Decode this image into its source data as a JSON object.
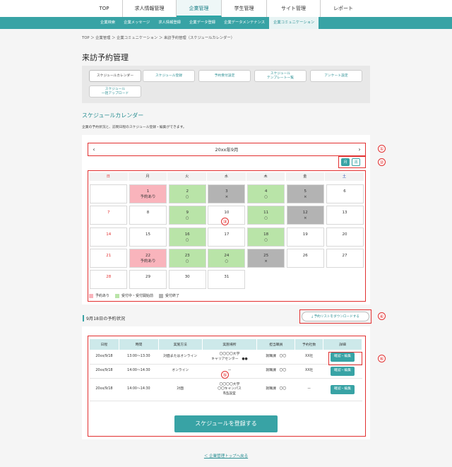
{
  "top_nav": [
    {
      "label": "TOP",
      "active": false
    },
    {
      "label": "求人情報管理",
      "active": false
    },
    {
      "label": "企業管理",
      "active": true
    },
    {
      "label": "学生管理",
      "active": false
    },
    {
      "label": "サイト管理",
      "active": false
    },
    {
      "label": "レポート",
      "active": false
    }
  ],
  "sub_nav": [
    {
      "label": "企業検索",
      "active": false
    },
    {
      "label": "企業メッセージ",
      "active": false
    },
    {
      "label": "求人情報登録",
      "active": false
    },
    {
      "label": "企業データ登録",
      "active": false
    },
    {
      "label": "企業データメンテナンス",
      "active": false
    },
    {
      "label": "企業コミュニケーション",
      "active": true
    }
  ],
  "breadcrumb": "TOP ＞ 企業管理 ＞ 企業コミュニケーション ＞ 来訪予約管理（スケジュールカレンダー）",
  "page_title": "来訪予約管理",
  "tabs": [
    {
      "label": "スケジュールカレンダー"
    },
    {
      "label": "スケジュール登録"
    },
    {
      "label": "予約受付設定"
    },
    {
      "label": "スケジュール\nテンプレート一覧"
    },
    {
      "label": "アンケート設定"
    },
    {
      "label": "スケジュール\n一括アップロード"
    }
  ],
  "section_title": "スケジュールカレンダー",
  "section_desc": "企業の予約状況と、訪問日程のスケジュール登録・編集ができます。",
  "calendar": {
    "month_label": "20xx年9月",
    "prev_icon": "‹",
    "next_icon": "›",
    "view_month": "月",
    "view_week": "週",
    "dow": [
      "日",
      "月",
      "火",
      "水",
      "木",
      "金",
      "土"
    ],
    "weeks": [
      [
        {
          "d": "",
          "s": "",
          "t": ""
        },
        {
          "d": "1",
          "s": "booked",
          "t": "予約あり"
        },
        {
          "d": "2",
          "s": "open",
          "t": "○"
        },
        {
          "d": "3",
          "s": "closed",
          "t": "×"
        },
        {
          "d": "4",
          "s": "open",
          "t": "○"
        },
        {
          "d": "5",
          "s": "closed",
          "t": "×"
        },
        {
          "d": "6",
          "s": "",
          "t": ""
        }
      ],
      [
        {
          "d": "7",
          "s": "",
          "t": ""
        },
        {
          "d": "8",
          "s": "",
          "t": ""
        },
        {
          "d": "9",
          "s": "open",
          "t": "○"
        },
        {
          "d": "10",
          "s": "",
          "t": ""
        },
        {
          "d": "11",
          "s": "open",
          "t": "○"
        },
        {
          "d": "12",
          "s": "closed",
          "t": "×"
        },
        {
          "d": "13",
          "s": "",
          "t": ""
        }
      ],
      [
        {
          "d": "14",
          "s": "",
          "t": ""
        },
        {
          "d": "15",
          "s": "",
          "t": ""
        },
        {
          "d": "16",
          "s": "open",
          "t": "○"
        },
        {
          "d": "17",
          "s": "",
          "t": ""
        },
        {
          "d": "18",
          "s": "open",
          "t": "○"
        },
        {
          "d": "19",
          "s": "",
          "t": ""
        },
        {
          "d": "20",
          "s": "",
          "t": ""
        }
      ],
      [
        {
          "d": "21",
          "s": "",
          "t": ""
        },
        {
          "d": "22",
          "s": "booked",
          "t": "予約あり"
        },
        {
          "d": "23",
          "s": "open",
          "t": "○"
        },
        {
          "d": "24",
          "s": "open",
          "t": "○"
        },
        {
          "d": "25",
          "s": "closed",
          "t": "×"
        },
        {
          "d": "26",
          "s": "",
          "t": ""
        },
        {
          "d": "27",
          "s": "",
          "t": ""
        }
      ],
      [
        {
          "d": "28",
          "s": "",
          "t": ""
        },
        {
          "d": "29",
          "s": "",
          "t": ""
        },
        {
          "d": "30",
          "s": "",
          "t": ""
        },
        {
          "d": "31",
          "s": "",
          "t": ""
        },
        {
          "d": "",
          "s": "none",
          "t": ""
        },
        {
          "d": "",
          "s": "none",
          "t": ""
        },
        {
          "d": "",
          "s": "none",
          "t": ""
        }
      ]
    ],
    "legend": [
      {
        "label": "予約あり",
        "color": "#f9b4bc"
      },
      {
        "label": "受付中・受付開始前",
        "color": "#b9e4a8"
      },
      {
        "label": "受付終了",
        "color": "#b3b3b3"
      }
    ]
  },
  "download_button": "予約リストをダウンロードする",
  "bookings_title": "9月18日の予約状況",
  "table": {
    "headers": [
      "日程",
      "時間",
      "実施方法",
      "実施場所",
      "担当職員",
      "予約社数",
      "詳細"
    ],
    "rows": [
      [
        "20xx/9/18",
        "13:00〜13:30",
        "対面またはオンライン",
        "〇〇〇〇大学\nキャリアセンター　●●",
        "就職課　〇〇",
        "XX社",
        "確認・編集"
      ],
      [
        "20xx/9/18",
        "14:00〜14:30",
        "オンライン",
        "ー",
        "就職課　〇〇",
        "XX社",
        "確認・編集"
      ],
      [
        "20xx/9/18",
        "14:00〜14:30",
        "対面",
        "〇〇〇〇大学\n〇〇キャンパス\nB品設室",
        "就職課　〇〇",
        "ー",
        "確認・編集"
      ]
    ]
  },
  "register_button": "スケジュールを登録する",
  "back_link": "＜ 企業管理トップへ戻る",
  "markers": [
    "①",
    "②",
    "③",
    "④",
    "⑤",
    "⑥"
  ],
  "colors": {
    "accent": "#38a3a5",
    "annotation": "#e23030"
  }
}
